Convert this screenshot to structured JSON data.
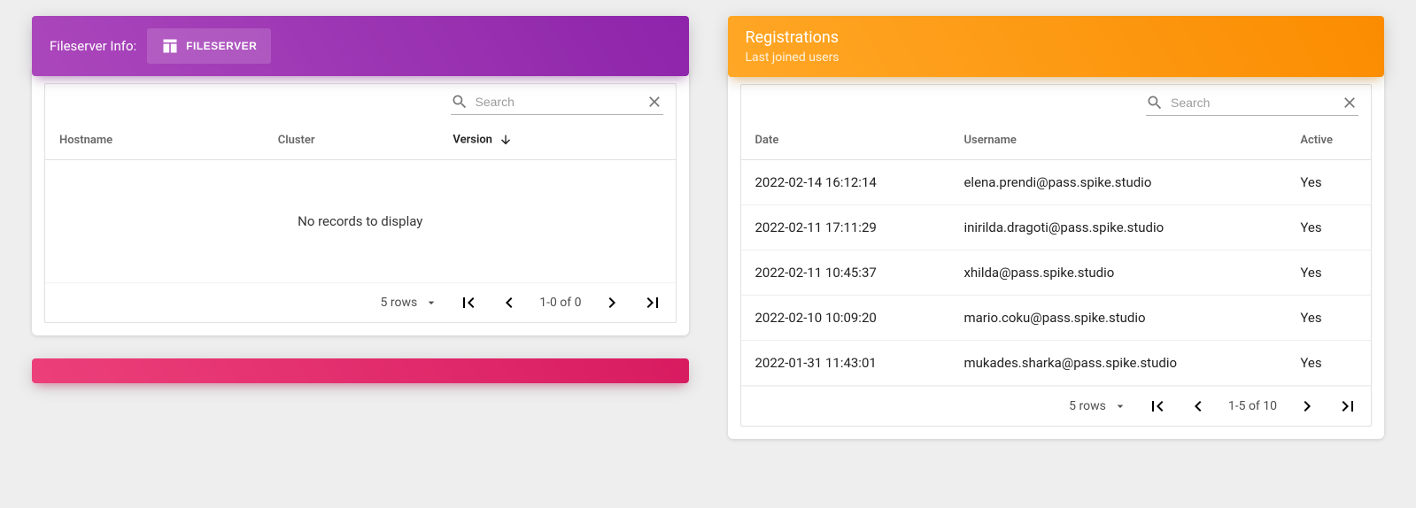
{
  "fileserver_card": {
    "title": "Fileserver Info:",
    "button_label": "FILESERVER",
    "search_placeholder": "Search",
    "columns": {
      "hostname": "Hostname",
      "cluster": "Cluster",
      "version": "Version"
    },
    "empty_message": "No records to display",
    "pager": {
      "rows_label": "5 rows",
      "range": "1-0 of 0"
    }
  },
  "registrations_card": {
    "title": "Registrations",
    "subtitle": "Last joined users",
    "search_placeholder": "Search",
    "columns": {
      "date": "Date",
      "username": "Username",
      "active": "Active"
    },
    "rows": [
      {
        "date": "2022-02-14 16:12:14",
        "username": "elena.prendi@pass.spike.studio",
        "active": "Yes"
      },
      {
        "date": "2022-02-11 17:11:29",
        "username": "inirilda.dragoti@pass.spike.studio",
        "active": "Yes"
      },
      {
        "date": "2022-02-11 10:45:37",
        "username": "xhilda@pass.spike.studio",
        "active": "Yes"
      },
      {
        "date": "2022-02-10 10:09:20",
        "username": "mario.coku@pass.spike.studio",
        "active": "Yes"
      },
      {
        "date": "2022-01-31 11:43:01",
        "username": "mukades.sharka@pass.spike.studio",
        "active": "Yes"
      }
    ],
    "pager": {
      "rows_label": "5 rows",
      "range": "1-5 of 10"
    }
  }
}
